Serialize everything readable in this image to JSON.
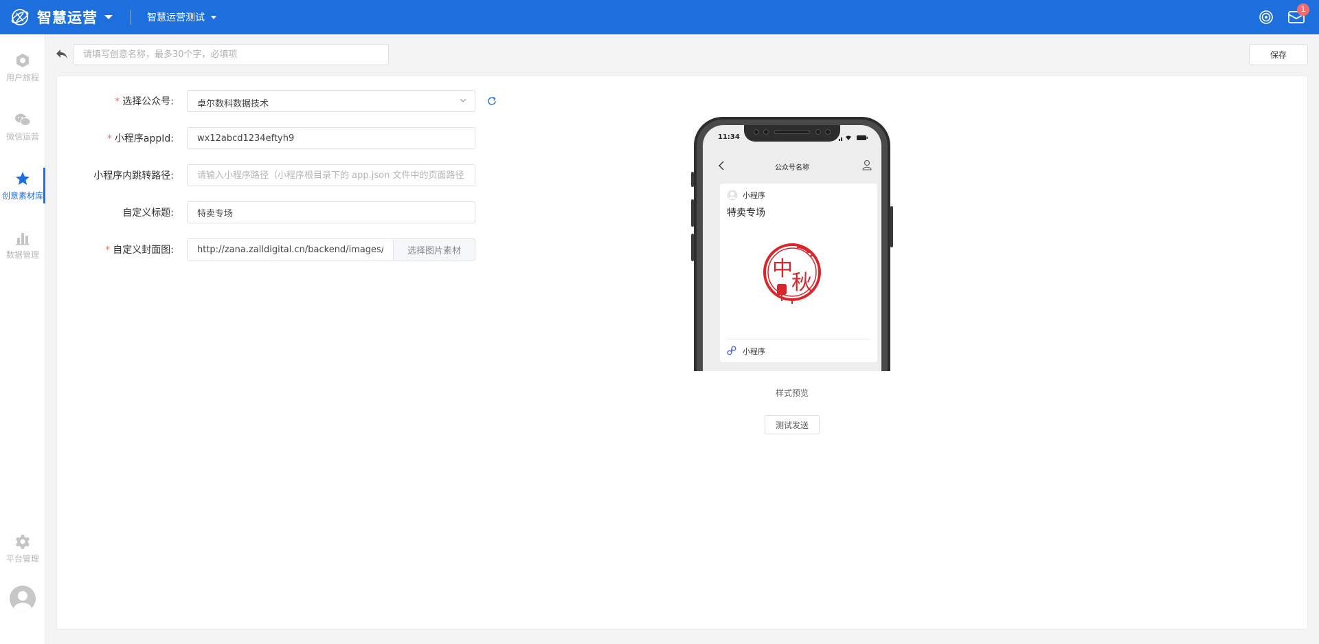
{
  "header": {
    "brand_name": "智慧运营",
    "project_name": "智慧运营测试",
    "mail_badge_count": "1",
    "brand_color": "#1c6fdc",
    "icons": [
      "app-logo-icon",
      "settings-icon",
      "mail-icon"
    ]
  },
  "sidebar": {
    "items": [
      {
        "label": "用户旅程",
        "icon": "journey-icon"
      },
      {
        "label": "微信运营",
        "icon": "wechat-icon"
      },
      {
        "label": "创意素材库",
        "icon": "star-icon",
        "active": true
      },
      {
        "label": "数据管理",
        "icon": "bar-chart-icon"
      },
      {
        "label": "平台管理",
        "icon": "gear-icon"
      }
    ]
  },
  "toolbar": {
    "name_placeholder": "请填写创意名称，最多30个字，必填项",
    "name_value": "",
    "save_label": "保存"
  },
  "form": {
    "account": {
      "label": "选择公众号:",
      "required": true,
      "value": "卓尔数科数据技术"
    },
    "appid": {
      "label": "小程序appId:",
      "required": true,
      "value": "wx12abcd1234eftyh9"
    },
    "path": {
      "label": "小程序内跳转路径:",
      "required": false,
      "value": "",
      "placeholder": "请输入小程序路径（小程序根目录下的 app.json 文件中的页面路径"
    },
    "title": {
      "label": "自定义标题:",
      "required": false,
      "value": "特卖专场"
    },
    "cover": {
      "label": "自定义封面图:",
      "required": true,
      "value": "http://zana.zalldigital.cn/backend/images/e",
      "button_label": "选择图片素材"
    },
    "required_mark": "*"
  },
  "preview": {
    "status_time": "11:34",
    "nav_title": "公众号名称",
    "app_name": "小程序",
    "card_title": "特卖专场",
    "cover_text": [
      "中",
      "秋"
    ],
    "footer_label": "小程序",
    "caption": "样式预览",
    "test_button_label": "测试发送",
    "cover_color": "#d9262b"
  }
}
